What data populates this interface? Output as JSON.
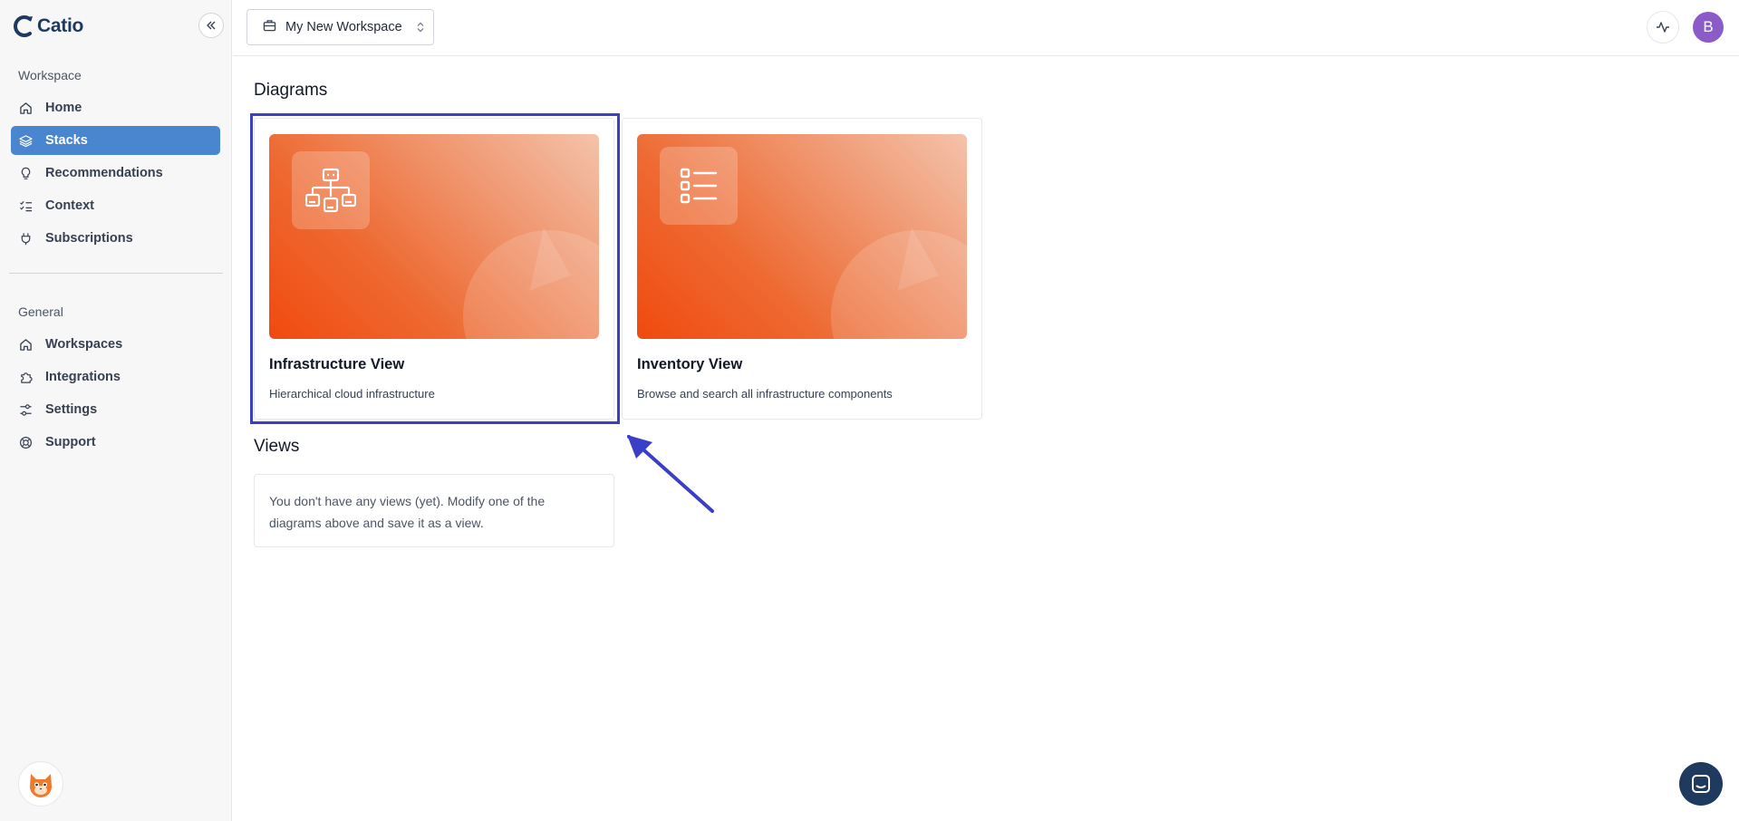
{
  "app": {
    "name": "Catio"
  },
  "sidebar": {
    "workspace_section": "Workspace",
    "workspace_items": [
      {
        "label": "Home",
        "icon": "home-icon",
        "active": false
      },
      {
        "label": "Stacks",
        "icon": "layers-icon",
        "active": true
      },
      {
        "label": "Recommendations",
        "icon": "lightbulb-icon",
        "active": false
      },
      {
        "label": "Context",
        "icon": "checklist-icon",
        "active": false
      },
      {
        "label": "Subscriptions",
        "icon": "plug-icon",
        "active": false
      }
    ],
    "general_section": "General",
    "general_items": [
      {
        "label": "Workspaces",
        "icon": "home-icon"
      },
      {
        "label": "Integrations",
        "icon": "puzzle-icon"
      },
      {
        "label": "Settings",
        "icon": "sliders-icon"
      },
      {
        "label": "Support",
        "icon": "lifebuoy-icon"
      }
    ]
  },
  "topbar": {
    "workspace_name": "My New Workspace",
    "avatar_initial": "B"
  },
  "main": {
    "diagrams_heading": "Diagrams",
    "cards": [
      {
        "title": "Infrastructure View",
        "description": "Hierarchical cloud infrastructure",
        "icon": "hierarchy-icon",
        "highlighted": true
      },
      {
        "title": "Inventory View",
        "description": "Browse and search all infrastructure components",
        "icon": "list-icon",
        "highlighted": false
      }
    ],
    "views_heading": "Views",
    "views_empty": "You don't have any views (yet). Modify one of the diagrams above and save it as a view."
  },
  "colors": {
    "accent": "#4a86d0",
    "brand_navy": "#1e3a5f",
    "annotation": "#3b3fc6",
    "avatar": "#8b5cc7",
    "card_gradient_start": "#f04a0e"
  }
}
